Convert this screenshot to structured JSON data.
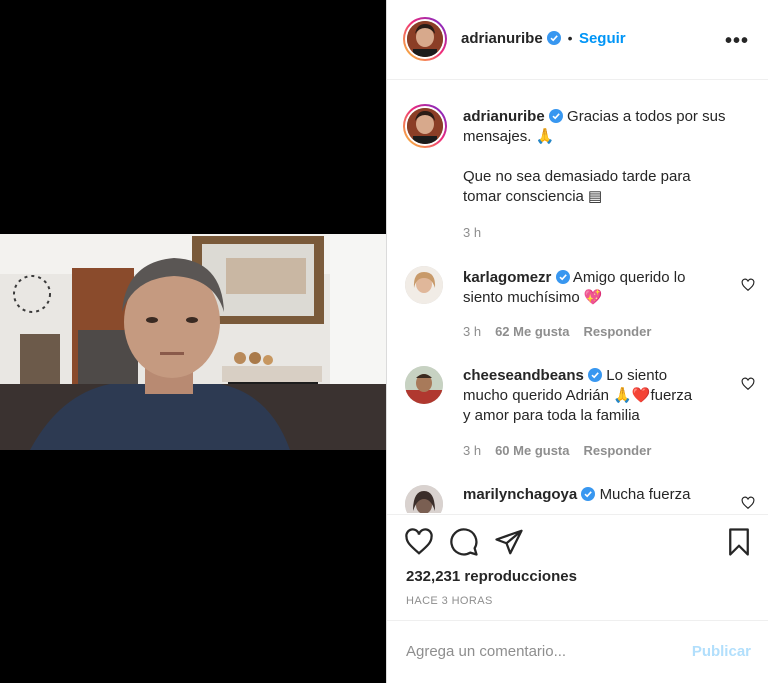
{
  "header": {
    "username": "adrianuribe",
    "separator": "•",
    "follow_label": "Seguir",
    "more_label": "•••"
  },
  "caption": {
    "username": "adrianuribe",
    "text_line1": "Gracias a todos por sus",
    "text_line2": "mensajes. 🙏",
    "text_line3": "Que no sea demasiado tarde para",
    "text_line4": "tomar consciencia ▤",
    "age": "3 h"
  },
  "comments": [
    {
      "username": "karlagomezr",
      "line1": "Amigo querido lo",
      "line2": "siento muchísimo 💖",
      "age": "3 h",
      "likes": "62 Me gusta",
      "reply": "Responder"
    },
    {
      "username": "cheeseandbeans",
      "line1": "Lo siento",
      "line2": "mucho querido Adrián 🙏❤️fuerza",
      "line3": "y amor para toda la familia",
      "age": "3 h",
      "likes": "60 Me gusta",
      "reply": "Responder"
    },
    {
      "username": "marilynchagoya",
      "line1": "Mucha fuerza"
    }
  ],
  "stats": {
    "views": "232,231 reproducciones",
    "posted": "HACE 3 HORAS"
  },
  "composer": {
    "placeholder": "Agrega un comentario...",
    "publish_label": "Publicar"
  },
  "colors": {
    "accent": "#0095f6",
    "verified": "#3897f0",
    "muted": "#8e8e8e",
    "publish_disabled": "#b2dffc"
  },
  "icons": [
    "like-icon",
    "comment-icon",
    "share-icon",
    "save-icon",
    "verified-icon",
    "more-icon"
  ]
}
